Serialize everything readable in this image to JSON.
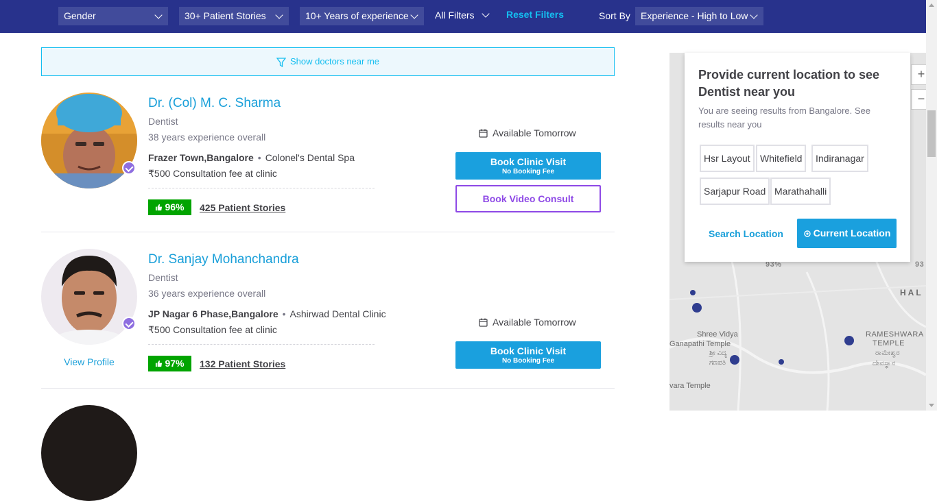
{
  "filters": {
    "gender": "Gender",
    "patient_stories": "30+ Patient Stories",
    "experience": "10+ Years of experience",
    "all_filters": "All Filters",
    "reset": "Reset Filters",
    "sort_label": "Sort By",
    "sort_value": "Experience - High to Low"
  },
  "near_me": "Show doctors near me",
  "doctors": [
    {
      "name": "Dr. (Col) M. C. Sharma",
      "specialty": "Dentist",
      "experience": "38 years experience overall",
      "locality": "Frazer Town,Bangalore",
      "clinic": "Colonel's Dental Spa",
      "fee": "₹500 Consultation fee at clinic",
      "rating": "96%",
      "stories": "425 Patient Stories",
      "availability": "Available Tomorrow",
      "book_clinic": "Book Clinic Visit",
      "book_clinic_sub": "No Booking Fee",
      "book_video": "Book Video Consult"
    },
    {
      "name": "Dr. Sanjay Mohanchandra",
      "specialty": "Dentist",
      "experience": "36 years experience overall",
      "locality": "JP Nagar 6 Phase,Bangalore",
      "clinic": "Ashirwad Dental Clinic",
      "fee": "₹500 Consultation fee at clinic",
      "rating": "97%",
      "stories": "132 Patient Stories",
      "availability": "Available Tomorrow",
      "book_clinic": "Book Clinic Visit",
      "book_clinic_sub": "No Booking Fee",
      "view_profile": "View Profile"
    }
  ],
  "location_popup": {
    "title": "Provide current location to see Dentist near you",
    "subtitle": "You are seeing results from Bangalore. See results near you",
    "chips": [
      "Hsr Layout",
      "Whitefield",
      "Indiranagar",
      "Sarjapur Road",
      "Marathahalli"
    ],
    "search_location": "Search Location",
    "current_location": "Current Location"
  },
  "map": {
    "labels": [
      "93%",
      "HAL",
      "RAMESHWARA",
      "TEMPLE",
      "ರಾಮೇಶ್ವರ",
      "ದೇವಸ್ಥಾನ",
      "Shree Vidya",
      "Ganapathi Temple",
      "ಶ್ರೀ ವಿದ್ಯ",
      "ಗಣಪತಿ",
      "vara Temple",
      "93"
    ],
    "zoom_in": "+",
    "zoom_out": "−"
  },
  "colors": {
    "header_bg": "#28328c",
    "accent": "#14bef0",
    "rating_green": "#01a400",
    "video_purple": "#8e49e6"
  }
}
